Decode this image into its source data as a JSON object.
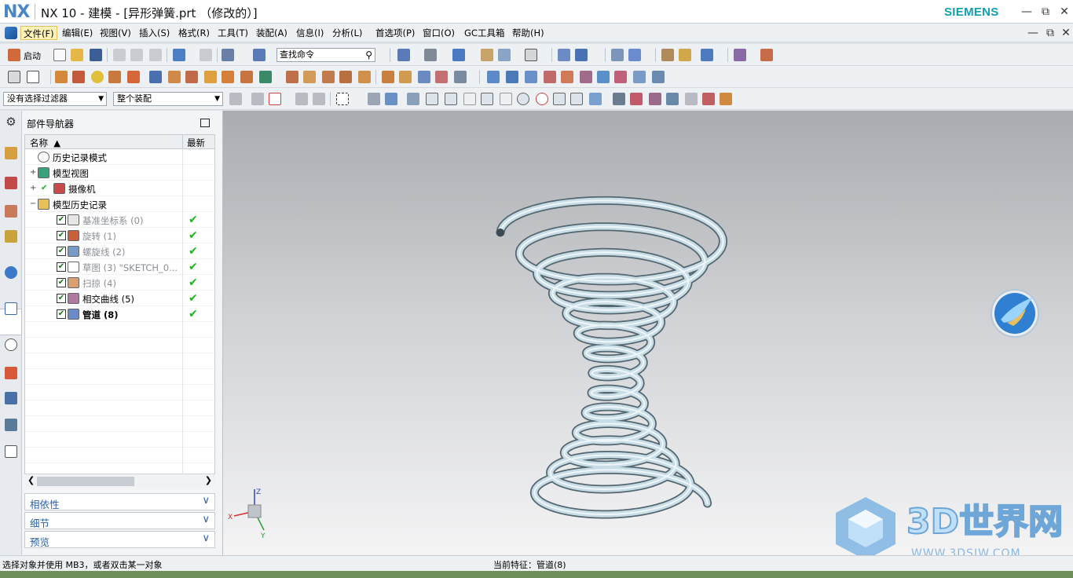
{
  "window": {
    "logo": "NX",
    "title": "NX 10 - 建模 - [异形弹簧.prt （修改的）]",
    "brand": "SIEMENS"
  },
  "menu": [
    {
      "id": "file",
      "label": "文件(F)"
    },
    {
      "id": "edit",
      "label": "编辑(E)"
    },
    {
      "id": "view",
      "label": "视图(V)"
    },
    {
      "id": "insert",
      "label": "插入(S)"
    },
    {
      "id": "format",
      "label": "格式(R)"
    },
    {
      "id": "tools",
      "label": "工具(T)"
    },
    {
      "id": "assembly",
      "label": "装配(A)"
    },
    {
      "id": "info",
      "label": "信息(I)"
    },
    {
      "id": "analysis",
      "label": "分析(L)"
    },
    {
      "id": "prefs",
      "label": "首选项(P)"
    },
    {
      "id": "window",
      "label": "窗口(O)"
    },
    {
      "id": "gc",
      "label": "GC工具箱"
    },
    {
      "id": "help",
      "label": "帮助(H)"
    }
  ],
  "toolbar": {
    "start_label": "启动",
    "search_placeholder": "查找命令",
    "selection_filter": "没有选择过滤器",
    "assembly_scope": "整个装配"
  },
  "navigator": {
    "title": "部件导航器",
    "col_name": "名称",
    "col_latest": "最新",
    "nodes": [
      {
        "label": "历史记录模式",
        "indent": 0,
        "expander": "",
        "checkbox": false,
        "dim": false,
        "bold": false,
        "latest": false,
        "icon": "clock-icon"
      },
      {
        "label": "模型视图",
        "indent": 0,
        "expander": "+",
        "checkbox": false,
        "dim": false,
        "bold": false,
        "latest": false,
        "icon": "model-views-icon"
      },
      {
        "label": "摄像机",
        "indent": 0,
        "expander": "+",
        "checkbox": false,
        "dim": false,
        "bold": false,
        "latest": false,
        "icon": "camera-icon",
        "check_mark": true
      },
      {
        "label": "模型历史记录",
        "indent": 0,
        "expander": "−",
        "checkbox": false,
        "dim": false,
        "bold": false,
        "latest": false,
        "icon": "folder-icon"
      },
      {
        "label": "基准坐标系 (0)",
        "indent": 1,
        "expander": "",
        "checkbox": true,
        "dim": true,
        "bold": false,
        "latest": true,
        "icon": "datum-csys-icon"
      },
      {
        "label": "旋转 (1)",
        "indent": 1,
        "expander": "",
        "checkbox": true,
        "dim": true,
        "bold": false,
        "latest": true,
        "icon": "revolve-icon"
      },
      {
        "label": "螺旋线 (2)",
        "indent": 1,
        "expander": "",
        "checkbox": true,
        "dim": true,
        "bold": false,
        "latest": true,
        "icon": "helix-icon"
      },
      {
        "label": "草图 (3) \"SKETCH_0...",
        "indent": 1,
        "expander": "",
        "checkbox": true,
        "dim": true,
        "bold": false,
        "latest": true,
        "icon": "sketch-icon"
      },
      {
        "label": "扫掠 (4)",
        "indent": 1,
        "expander": "",
        "checkbox": true,
        "dim": true,
        "bold": false,
        "latest": true,
        "icon": "sweep-icon"
      },
      {
        "label": "相交曲线 (5)",
        "indent": 1,
        "expander": "",
        "checkbox": true,
        "dim": false,
        "bold": false,
        "latest": true,
        "icon": "intersection-curve-icon"
      },
      {
        "label": "管道 (8)",
        "indent": 1,
        "expander": "",
        "checkbox": true,
        "dim": false,
        "bold": true,
        "latest": true,
        "icon": "tube-icon"
      }
    ],
    "panels": [
      "相依性",
      "细节",
      "预览"
    ]
  },
  "viewport": {
    "triad_labels": {
      "x": "X",
      "y": "Y",
      "z": "Z"
    },
    "watermark_text": "3D世界网",
    "watermark_url": "WWW.3DSJW.COM"
  },
  "status": {
    "left": "选择对象并使用 MB3，或者双击某一对象",
    "current_feature": "当前特征：管道(8)"
  },
  "colors": {
    "accent": "#4a86c5",
    "brand": "#0f9fb0",
    "latest_tick": "#19b319",
    "spring": "#c9dde6"
  }
}
